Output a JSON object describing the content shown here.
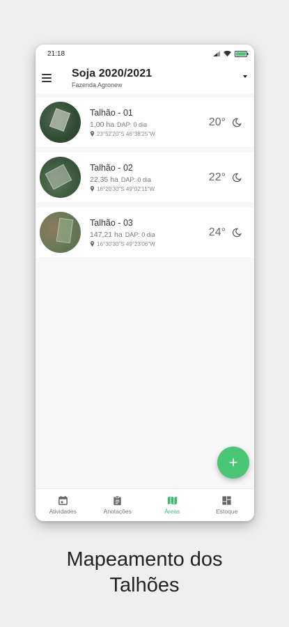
{
  "statusbar": {
    "time": "21:18"
  },
  "appbar": {
    "title": "Soja 2020/2021",
    "subtitle": "Fazenda Agronew"
  },
  "fields": [
    {
      "name": "Talhão - 01",
      "area": "1,00 ha",
      "dap": "DAP: 0 dia",
      "coords": "23°52'20\"S 46°38'25\"W",
      "temp": "20°"
    },
    {
      "name": "Talhão - 02",
      "area": "22,35 ha",
      "dap": "DAP: 0 dia",
      "coords": "16°20'30\"S 49°02'11\"W",
      "temp": "22°"
    },
    {
      "name": "Talhão - 03",
      "area": "147,21 ha",
      "dap": "DAP: 0 dia",
      "coords": "16°30'30\"S 49°23'06\"W",
      "temp": "24°"
    }
  ],
  "fab": {
    "label": "+"
  },
  "nav": [
    {
      "label": "Atividades",
      "icon": "calendar-icon"
    },
    {
      "label": "Anotações",
      "icon": "clipboard-icon"
    },
    {
      "label": "Áreas",
      "icon": "map-icon"
    },
    {
      "label": "Estoque",
      "icon": "dashboard-icon"
    }
  ],
  "caption": {
    "line1": "Mapeamento dos",
    "line2": "Talhões"
  },
  "colors": {
    "accent": "#48c675",
    "active_nav": "#3fb86a"
  }
}
